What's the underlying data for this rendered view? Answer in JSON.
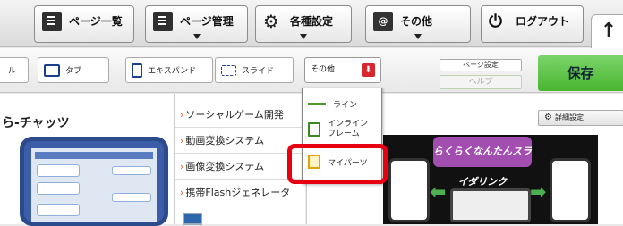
{
  "nav": {
    "page_list": "ページ一覧",
    "page_manage": "ページ管理",
    "settings": "各種設定",
    "other": "その他",
    "logout": "ログアウト",
    "home_arrow": "↑"
  },
  "toolbar": {
    "left_fragment": "ル",
    "tab": "タブ",
    "expand": "エキスパンド",
    "slide": "スライド",
    "other_dropdown": "その他",
    "dropdown_arrow": "⬇",
    "page_settings": "ページ設定",
    "help": "ヘルプ",
    "save": "保存"
  },
  "left_panel": {
    "title": "ら-チャッツ"
  },
  "mid_panel": {
    "links": [
      "ソーシャルゲーム開発",
      "動画変換システム",
      "画像変換システム",
      "携帯Flashジェネレータ"
    ]
  },
  "right_panel": {
    "detail_settings": "詳細設定",
    "banner": "らくらくなんたんスライダリンク"
  },
  "menu": {
    "line": "ライン",
    "inline_frame": "インライン\nフレーム",
    "my_parts": "マイパーツ"
  },
  "colors": {
    "save_green": "#49b52f",
    "highlight_red": "#e60012",
    "dropdown_red": "#d7262c"
  }
}
